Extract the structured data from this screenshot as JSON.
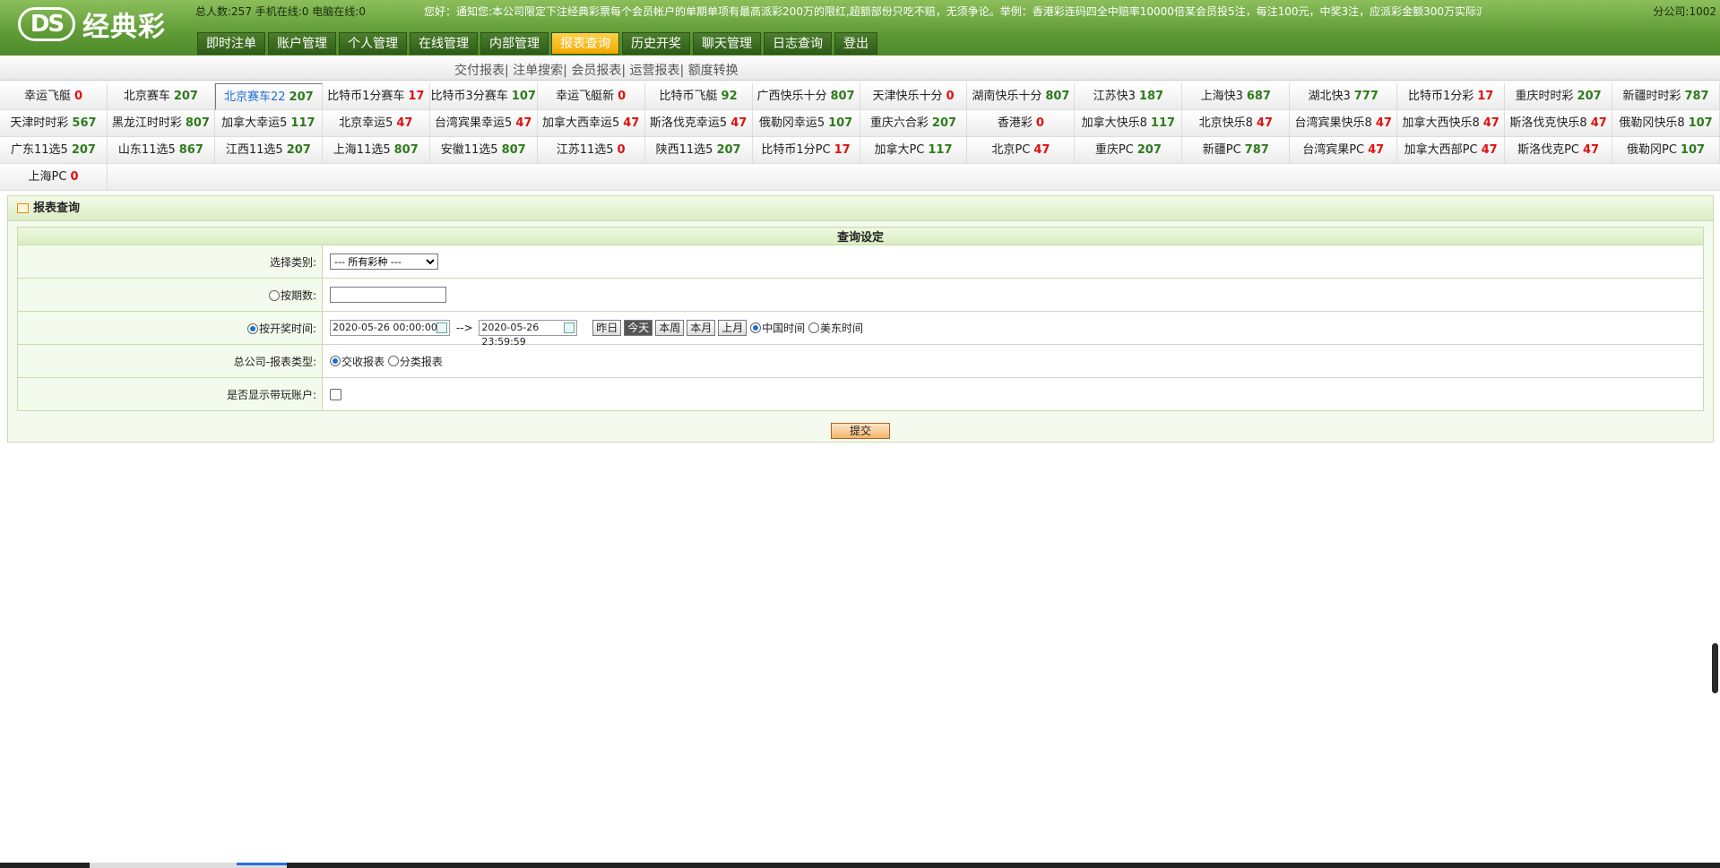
{
  "brand": {
    "ds": "DS",
    "name": "经典彩"
  },
  "stats": {
    "total_label": "总人数:",
    "total": "257",
    "mobile_label": "手机在线:",
    "mobile": "0",
    "pc_label": "电脑在线:",
    "pc": "0"
  },
  "notice": "您好：通知您:本公司限定下注经典彩票每个会员帐户的单期单项有最高派彩200万的限红,超额部份只吃不赔，无须争论。举例：香港彩连码四全中赔率10000倍某会员投5注，每注100元，中奖3注，应派彩金额300万实际派",
  "branch": "分公司:1002",
  "nav": [
    "即时注单",
    "账户管理",
    "个人管理",
    "在线管理",
    "内部管理",
    "报表查询",
    "历史开奖",
    "聊天管理",
    "日志查询",
    "登出"
  ],
  "nav_active": 5,
  "subnav": [
    "交付报表",
    "注单搜索",
    "会员报表",
    "运营报表",
    "额度转换"
  ],
  "lotteries": [
    [
      {
        "name": "幸运飞艇",
        "count": "0",
        "color": "red"
      },
      {
        "name": "北京赛车",
        "count": "207",
        "color": "green"
      },
      {
        "name": "北京赛车22",
        "count": "207",
        "color": "green",
        "selected": true
      },
      {
        "name": "比特币1分赛车",
        "count": "17",
        "color": "red"
      },
      {
        "name": "比特币3分赛车",
        "count": "107",
        "color": "green"
      },
      {
        "name": "幸运飞艇新",
        "count": "0",
        "color": "red"
      },
      {
        "name": "比特币飞艇",
        "count": "92",
        "color": "green"
      },
      {
        "name": "广西快乐十分",
        "count": "807",
        "color": "green"
      },
      {
        "name": "天津快乐十分",
        "count": "0",
        "color": "red"
      },
      {
        "name": "湖南快乐十分",
        "count": "807",
        "color": "green"
      },
      {
        "name": "江苏快3",
        "count": "187",
        "color": "green"
      },
      {
        "name": "上海快3",
        "count": "687",
        "color": "green"
      },
      {
        "name": "湖北快3",
        "count": "777",
        "color": "green"
      },
      {
        "name": "比特币1分彩",
        "count": "17",
        "color": "red"
      },
      {
        "name": "重庆时时彩",
        "count": "207",
        "color": "green"
      },
      {
        "name": "新疆时时彩",
        "count": "787",
        "color": "green"
      }
    ],
    [
      {
        "name": "天津时时彩",
        "count": "567",
        "color": "green"
      },
      {
        "name": "黑龙江时时彩",
        "count": "807",
        "color": "green"
      },
      {
        "name": "加拿大幸运5",
        "count": "117",
        "color": "green"
      },
      {
        "name": "北京幸运5",
        "count": "47",
        "color": "red"
      },
      {
        "name": "台湾宾果幸运5",
        "count": "47",
        "color": "red"
      },
      {
        "name": "加拿大西幸运5",
        "count": "47",
        "color": "red"
      },
      {
        "name": "斯洛伐克幸运5",
        "count": "47",
        "color": "red"
      },
      {
        "name": "俄勒冈幸运5",
        "count": "107",
        "color": "green"
      },
      {
        "name": "重庆六合彩",
        "count": "207",
        "color": "green"
      },
      {
        "name": "香港彩",
        "count": "0",
        "color": "red"
      },
      {
        "name": "加拿大快乐8",
        "count": "117",
        "color": "green"
      },
      {
        "name": "北京快乐8",
        "count": "47",
        "color": "red"
      },
      {
        "name": "台湾宾果快乐8",
        "count": "47",
        "color": "red"
      },
      {
        "name": "加拿大西快乐8",
        "count": "47",
        "color": "red"
      },
      {
        "name": "斯洛伐克快乐8",
        "count": "47",
        "color": "red"
      },
      {
        "name": "俄勒冈快乐8",
        "count": "107",
        "color": "green"
      }
    ],
    [
      {
        "name": "广东11选5",
        "count": "207",
        "color": "green"
      },
      {
        "name": "山东11选5",
        "count": "867",
        "color": "green"
      },
      {
        "name": "江西11选5",
        "count": "207",
        "color": "green"
      },
      {
        "name": "上海11选5",
        "count": "807",
        "color": "green"
      },
      {
        "name": "安徽11选5",
        "count": "807",
        "color": "green"
      },
      {
        "name": "江苏11选5",
        "count": "0",
        "color": "red"
      },
      {
        "name": "陕西11选5",
        "count": "207",
        "color": "green"
      },
      {
        "name": "比特币1分PC",
        "count": "17",
        "color": "red"
      },
      {
        "name": "加拿大PC",
        "count": "117",
        "color": "green"
      },
      {
        "name": "北京PC",
        "count": "47",
        "color": "red"
      },
      {
        "name": "重庆PC",
        "count": "207",
        "color": "green"
      },
      {
        "name": "新疆PC",
        "count": "787",
        "color": "green"
      },
      {
        "name": "台湾宾果PC",
        "count": "47",
        "color": "red"
      },
      {
        "name": "加拿大西部PC",
        "count": "47",
        "color": "red"
      },
      {
        "name": "斯洛伐克PC",
        "count": "47",
        "color": "red"
      },
      {
        "name": "俄勒冈PC",
        "count": "107",
        "color": "green"
      }
    ],
    [
      {
        "name": "上海PC",
        "count": "0",
        "color": "red"
      }
    ]
  ],
  "panel": {
    "title": "报表查询",
    "header": "查询设定",
    "category_label": "选择类别:",
    "category_value": "--- 所有彩种 ---",
    "period_label": "按期数:",
    "period_value": "",
    "time_label": "按开奖时间:",
    "time_from": "2020-05-26 00:00:00",
    "time_sep": "-->",
    "time_to": "2020-05-26 23:59:59",
    "quick": [
      "昨日",
      "今天",
      "本周",
      "本月",
      "上月"
    ],
    "quick_active": 1,
    "tz_china": "中国时间",
    "tz_us": "美东时间",
    "type_label": "总公司-报表类型:",
    "type_a": "交收报表",
    "type_b": "分类报表",
    "show_label": "是否显示带玩账户:",
    "submit": "提交"
  },
  "colors": {
    "green": "#2f7a1c",
    "red": "#e01010",
    "nav_active": "#f0a800",
    "header_bg": "#5e9a35"
  }
}
